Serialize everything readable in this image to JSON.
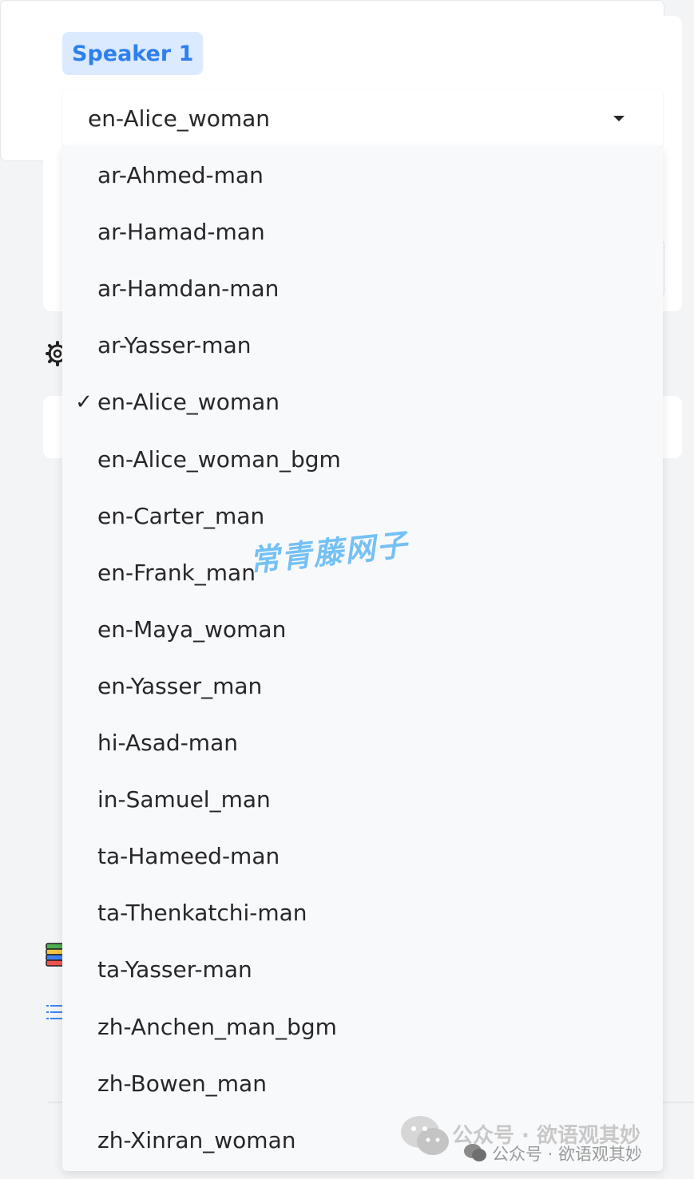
{
  "speaker": {
    "badge_label": "Speaker 1",
    "selected_voice": "en-Alice_woman"
  },
  "dropdown": {
    "check_mark": "✓",
    "selected_index": 4,
    "options": [
      "ar-Ahmed-man",
      "ar-Hamad-man",
      "ar-Hamdan-man",
      "ar-Yasser-man",
      "en-Alice_woman",
      "en-Alice_woman_bgm",
      "en-Carter_man",
      "en-Frank_man",
      "en-Maya_woman",
      "en-Yasser_man",
      "hi-Asad-man",
      "in-Samuel_man",
      "ta-Hameed-man",
      "ta-Thenkatchi-man",
      "ta-Yasser-man",
      "zh-Anchen_man_bgm",
      "zh-Bowen_man",
      "zh-Xinran_woman"
    ]
  },
  "icons": {
    "gear": "gear-icon",
    "books": "books-icon",
    "list": "list-icon",
    "caret": "chevron-down-icon"
  },
  "colors": {
    "accent": "#2f80ed",
    "badge_bg": "#dbeafe",
    "dropdown_bg": "#f8f9fb",
    "page_bg": "#f3f4f6"
  },
  "watermark": {
    "text": "常青藤网子",
    "wechat_big": "公众号 · 欲语观其妙",
    "wechat_small": "公众号 · 欲语观其妙"
  }
}
